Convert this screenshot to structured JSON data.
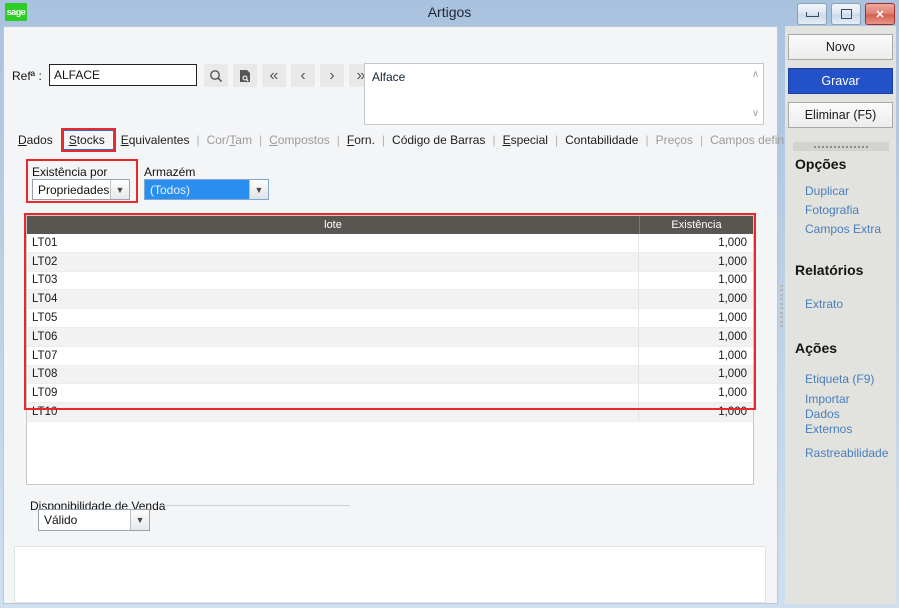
{
  "window": {
    "title": "Artigos",
    "logo_text": "sage",
    "buttons": {
      "minimize": "minimize-icon",
      "maximize": "maximize-icon",
      "close": "✕"
    }
  },
  "toolbar": {
    "ref_label": "Refª :",
    "ref_value": "ALFACE",
    "icons": [
      {
        "name": "search-icon",
        "glyph": "search"
      },
      {
        "name": "document-search-icon",
        "glyph": "doc"
      },
      {
        "name": "first-record-icon",
        "glyph": "«"
      },
      {
        "name": "previous-record-icon",
        "glyph": "‹"
      },
      {
        "name": "next-record-icon",
        "glyph": "›"
      },
      {
        "name": "last-record-icon",
        "glyph": "»"
      }
    ]
  },
  "description": {
    "value": "Alface",
    "scroll_up": "∧",
    "scroll_down": "∨"
  },
  "tabs": [
    {
      "label": "Dados",
      "accel": "D",
      "active": false,
      "disabled": false
    },
    {
      "label": "Stocks",
      "accel": "S",
      "active": true,
      "disabled": false
    },
    {
      "label": "Equivalentes",
      "accel": "E",
      "active": false,
      "disabled": false
    },
    {
      "label": "Cor/Tam",
      "accel": "T",
      "active": false,
      "disabled": true
    },
    {
      "label": "Compostos",
      "accel": "C",
      "active": false,
      "disabled": true
    },
    {
      "label": "Forn.",
      "accel": "F",
      "active": false,
      "disabled": false
    },
    {
      "label": "Código de Barras",
      "accel": "",
      "active": false,
      "disabled": false
    },
    {
      "label": "Especial",
      "accel": "E",
      "active": false,
      "disabled": false
    },
    {
      "label": "Contabilidade",
      "accel": "",
      "active": false,
      "disabled": false
    },
    {
      "label": "Preços",
      "accel": "",
      "active": false,
      "disabled": true
    },
    {
      "label": "Campos definíveis",
      "accel": "",
      "active": false,
      "disabled": true
    }
  ],
  "filters": {
    "existencia_por": {
      "label": "Existência por",
      "value": "Propriedades"
    },
    "armazem": {
      "label": "Armazém",
      "value": "(Todos)",
      "selected": true
    }
  },
  "grid": {
    "columns": [
      "lote",
      "Existência"
    ],
    "rows": [
      {
        "lote": "LT01",
        "existencia": "1,000"
      },
      {
        "lote": "LT02",
        "existencia": "1,000"
      },
      {
        "lote": "LT03",
        "existencia": "1,000"
      },
      {
        "lote": "LT04",
        "existencia": "1,000"
      },
      {
        "lote": "LT05",
        "existencia": "1,000"
      },
      {
        "lote": "LT06",
        "existencia": "1,000"
      },
      {
        "lote": "LT07",
        "existencia": "1,000"
      },
      {
        "lote": "LT08",
        "existencia": "1,000"
      },
      {
        "lote": "LT09",
        "existencia": "1,000"
      },
      {
        "lote": "LT10",
        "existencia": "1,000"
      }
    ]
  },
  "disponibilidade": {
    "label": "Disponibilidade de Venda",
    "value": "Válido"
  },
  "sidebar": {
    "buttons": [
      {
        "label": "Novo",
        "primary": false
      },
      {
        "label": "Gravar",
        "primary": true
      },
      {
        "label": "Eliminar (F5)",
        "primary": false
      }
    ],
    "sections": [
      {
        "title": "Opções",
        "links": [
          "Duplicar",
          "Fotografia",
          "Campos Extra"
        ]
      },
      {
        "title": "Relatórios",
        "links": [
          "Extrato"
        ]
      },
      {
        "title": "Ações",
        "links": [
          "Etiqueta (F9)",
          "Importar",
          "Dados",
          "Externos",
          "Rastreabilidade"
        ]
      }
    ]
  },
  "colors": {
    "accent_blue": "#2251c8",
    "annotation_red": "#e8282a",
    "grid_header": "#595651",
    "link_blue": "#4a7ebb",
    "selected_blue": "#2a8ef0"
  }
}
